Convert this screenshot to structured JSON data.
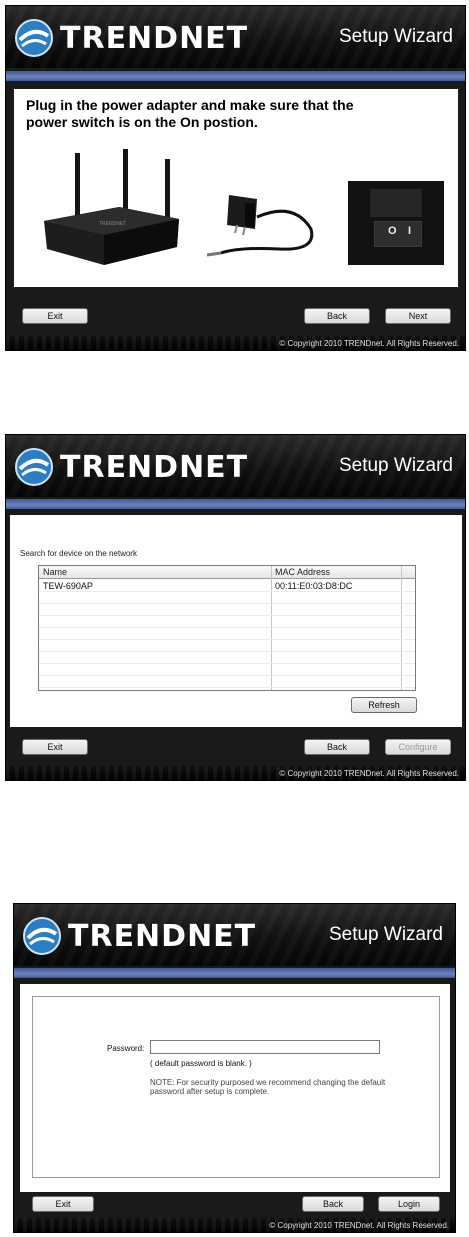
{
  "brand": {
    "logo_text": "TRENDNET",
    "wizard_title": "Setup Wizard",
    "copyright": "© Copyright 2010 TRENDnet. All Rights Reserved."
  },
  "colors": {
    "header_bg": "#111111",
    "band": "#5470b0",
    "content_bg": "#ffffff"
  },
  "panel1": {
    "instruction": "Plug in the power adapter and make sure that the power switch is on the On postion.",
    "images": [
      "router-image",
      "power-adapter-image",
      "power-switch-image"
    ],
    "switch_labels": [
      "O",
      "I"
    ],
    "buttons": {
      "exit": "Exit",
      "back": "Back",
      "next": "Next"
    }
  },
  "panel2": {
    "search_label": "Search for device on the network",
    "columns": [
      "Name",
      "MAC Address"
    ],
    "rows": [
      {
        "name": "TEW-690AP",
        "mac": "00:11:E0:03:D8:DC"
      }
    ],
    "refresh": "Refresh",
    "buttons": {
      "exit": "Exit",
      "back": "Back",
      "configure": "Configure"
    }
  },
  "panel3": {
    "password_label": "Password:",
    "password_value": "",
    "hint": "( default password is blank. )",
    "note": "NOTE: For security purposed we recommend changing the default password after setup is complete.",
    "buttons": {
      "exit": "Exit",
      "back": "Back",
      "login": "Login"
    }
  }
}
